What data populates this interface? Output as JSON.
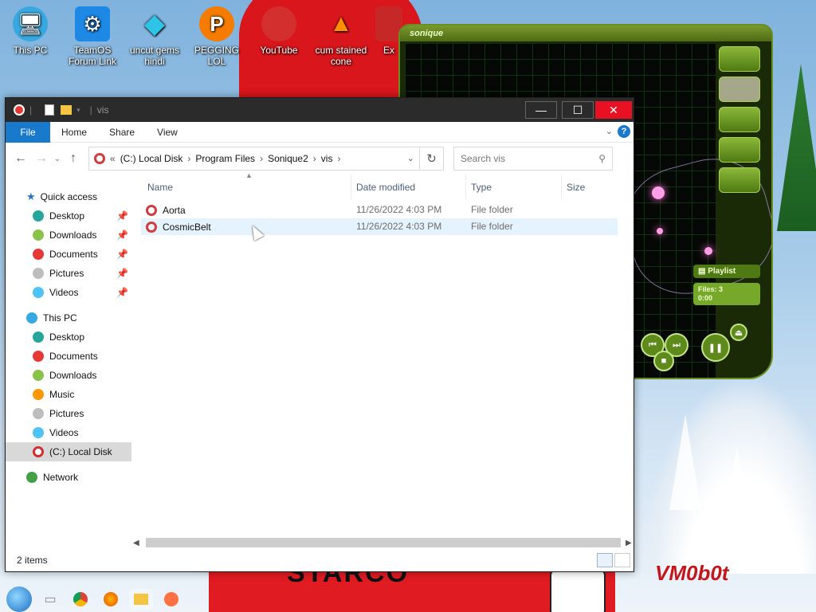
{
  "desktop": {
    "icons": [
      {
        "label": "This PC",
        "icon": "monitor-icon",
        "color": "#38a9e0"
      },
      {
        "label": "TeamOS Forum Link",
        "icon": "gear-icon",
        "color": "#1e88e5"
      },
      {
        "label": "uncut gems hindi",
        "icon": "diamond-icon",
        "color": "#2ec4e8"
      },
      {
        "label": "PEGGING LOL",
        "icon": "p-logo-icon",
        "color": "#f57c00"
      },
      {
        "label": "YouTube",
        "icon": "angry-bird-icon",
        "color": "#d32f2f"
      },
      {
        "label": "cum stained cone",
        "icon": "traffic-cone-icon",
        "color": "#ff8f00"
      },
      {
        "label": "Ex",
        "icon": "app-icon",
        "color": "#c62828"
      }
    ],
    "watermark": "VM0b0t",
    "background_text": "STARCO"
  },
  "sonique": {
    "title": "sonique",
    "playlist_label": "Playlist",
    "files_label": "Files: 3",
    "time": "0:00",
    "accent": "#8bb83a"
  },
  "explorer": {
    "title": "vis",
    "ribbon": {
      "file": "File",
      "home": "Home",
      "share": "Share",
      "view": "View"
    },
    "breadcrumb": [
      "(C:) Local Disk",
      "Program Files",
      "Sonique2",
      "vis"
    ],
    "search_placeholder": "Search vis",
    "nav": {
      "quick_access": "Quick access",
      "quick_items": [
        {
          "label": "Desktop",
          "color": "#26a69a"
        },
        {
          "label": "Downloads",
          "color": "#8bc34a"
        },
        {
          "label": "Documents",
          "color": "#e53935"
        },
        {
          "label": "Pictures",
          "color": "#bdbdbd"
        },
        {
          "label": "Videos",
          "color": "#4fc3f7"
        }
      ],
      "this_pc": "This PC",
      "pc_items": [
        {
          "label": "Desktop",
          "color": "#26a69a"
        },
        {
          "label": "Documents",
          "color": "#e53935"
        },
        {
          "label": "Downloads",
          "color": "#8bc34a"
        },
        {
          "label": "Music",
          "color": "#ff9800"
        },
        {
          "label": "Pictures",
          "color": "#bdbdbd"
        },
        {
          "label": "Videos",
          "color": "#4fc3f7"
        },
        {
          "label": "(C:) Local Disk",
          "color": "#d32f2f"
        }
      ],
      "network": "Network"
    },
    "columns": {
      "name": "Name",
      "date": "Date modified",
      "type": "Type",
      "size": "Size"
    },
    "rows": [
      {
        "name": "Aorta",
        "date": "11/26/2022 4:03 PM",
        "type": "File folder",
        "size": ""
      },
      {
        "name": "CosmicBelt",
        "date": "11/26/2022 4:03 PM",
        "type": "File folder",
        "size": ""
      }
    ],
    "status": "2 items",
    "accent": "#1979ca"
  }
}
